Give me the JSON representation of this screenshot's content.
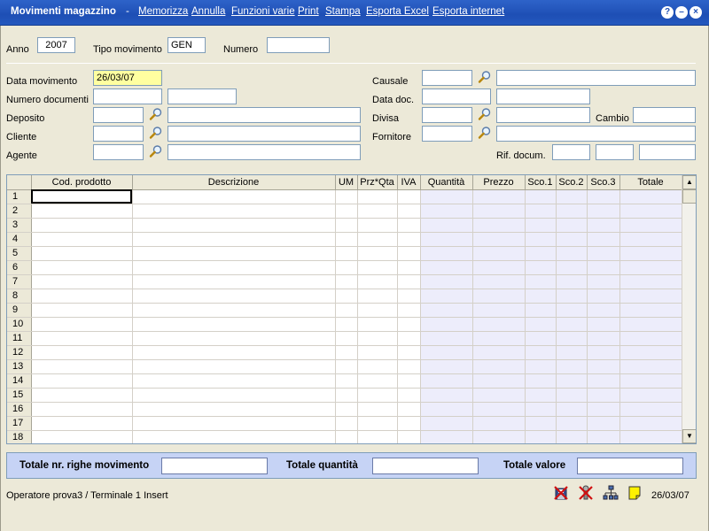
{
  "window": {
    "title": "Movimenti magazzino",
    "separator": "-",
    "menu": [
      "Memorizza",
      "Annulla",
      "Funzioni varie",
      "Print",
      "Stampa",
      "Esporta Excel",
      "Esporta internet"
    ],
    "controls": {
      "help": "?",
      "minimize": "–",
      "close": "×"
    }
  },
  "header": {
    "anno_label": "Anno",
    "anno_value": "2007",
    "tipo_label": "Tipo movimento",
    "tipo_value": "GEN",
    "numero_label": "Numero",
    "numero_value": ""
  },
  "form": {
    "data_movimento_label": "Data movimento",
    "data_movimento_value": "26/03/07",
    "numero_documenti_label": "Numero documenti",
    "deposito_label": "Deposito",
    "cliente_label": "Cliente",
    "agente_label": "Agente",
    "causale_label": "Causale",
    "data_doc_label": "Data doc.",
    "divisa_label": "Divisa",
    "cambio_label": "Cambio",
    "fornitore_label": "Fornitore",
    "rif_docum_label": "Rif. docum."
  },
  "grid": {
    "columns": [
      "Cod. prodotto",
      "Descrizione",
      "UM",
      "Prz*Qta",
      "IVA",
      "Quantità",
      "Prezzo",
      "Sco.1",
      "Sco.2",
      "Sco.3",
      "Totale"
    ],
    "rows": [
      "1",
      "2",
      "3",
      "4",
      "5",
      "6",
      "7",
      "8",
      "9",
      "10",
      "11",
      "12",
      "13",
      "14",
      "15",
      "16",
      "17",
      "18"
    ],
    "numeric_column_color": "#EDEDFB"
  },
  "totals": {
    "righe_label": "Totale nr. righe movimento",
    "quantita_label": "Totale quantità",
    "valore_label": "Totale valore"
  },
  "status": {
    "operator_text": "Operatore prova3 / Terminale 1   Insert",
    "date": "26/03/07",
    "icons": [
      "disk-no-icon",
      "tools-no-icon",
      "network-icon",
      "note-icon"
    ]
  },
  "colors": {
    "titlebar": "#2458BE",
    "totals_panel": "#C6D3F5",
    "date_highlight": "#FFFFA0"
  }
}
